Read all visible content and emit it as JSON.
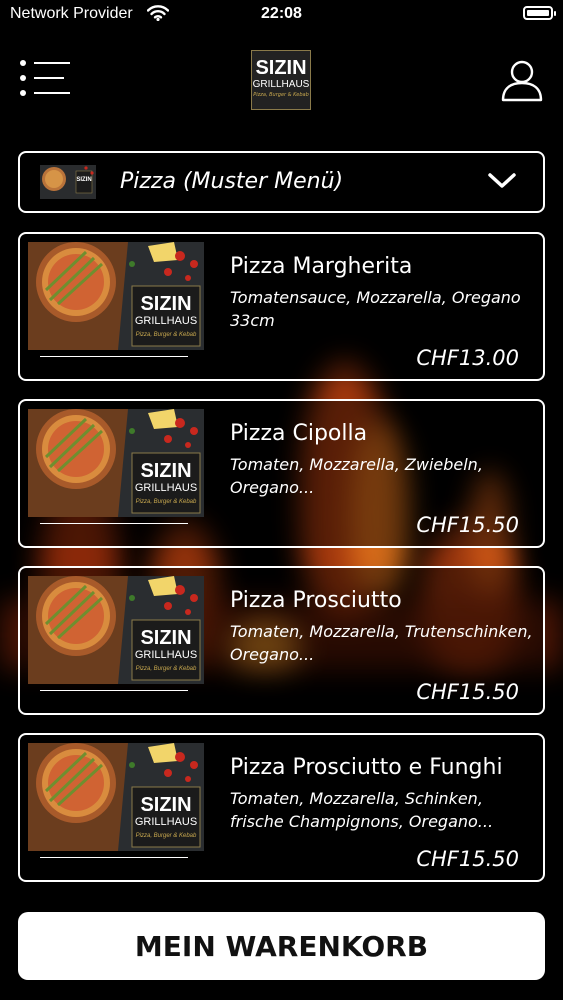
{
  "status_bar": {
    "carrier": "Network Provider",
    "time": "22:08",
    "icons": [
      "wifi-icon",
      "battery-icon"
    ]
  },
  "header": {
    "logo": {
      "line1": "SIZIN",
      "line2": "GRILLHAUS",
      "tagline": "Pizza, Burger & Kebab"
    },
    "menu_icon": "hamburger-menu-icon",
    "user_icon": "user-icon"
  },
  "category": {
    "selected": "Pizza (Muster Menü)",
    "thumb_logo": "SIZIN",
    "icon": "chevron-down-icon"
  },
  "products": [
    {
      "name": "Pizza Margherita",
      "description": "Tomatensauce, Mozzarella, Oregano 33cm",
      "price": "CHF13.00",
      "image_logo_line1": "SIZIN",
      "image_logo_line2": "GRILLHAUS",
      "image_logo_tag": "Pizza, Burger & Kebab"
    },
    {
      "name": "Pizza Cipolla",
      "description": "Tomaten, Mozzarella, Zwiebeln, Oregano...",
      "price": "CHF15.50",
      "image_logo_line1": "SIZIN",
      "image_logo_line2": "GRILLHAUS",
      "image_logo_tag": "Pizza, Burger & Kebab"
    },
    {
      "name": "Pizza Prosciutto",
      "description": "Tomaten, Mozzarella, Trutenschinken, Oregano...",
      "price": "CHF15.50",
      "image_logo_line1": "SIZIN",
      "image_logo_line2": "GRILLHAUS",
      "image_logo_tag": "Pizza, Burger & Kebab"
    },
    {
      "name": "Pizza Prosciutto e Funghi",
      "description": "Tomaten, Mozzarella, Schinken, frische Champignons, Oregano...",
      "price": "CHF15.50",
      "image_logo_line1": "SIZIN",
      "image_logo_line2": "GRILLHAUS",
      "image_logo_tag": "Pizza, Burger & Kebab"
    }
  ],
  "cart_button": {
    "label": "MEIN WARENKORB"
  },
  "colors": {
    "background": "#000000",
    "accent_gold": "#c9a94f",
    "flame": "#e8561a",
    "text": "#ffffff"
  }
}
